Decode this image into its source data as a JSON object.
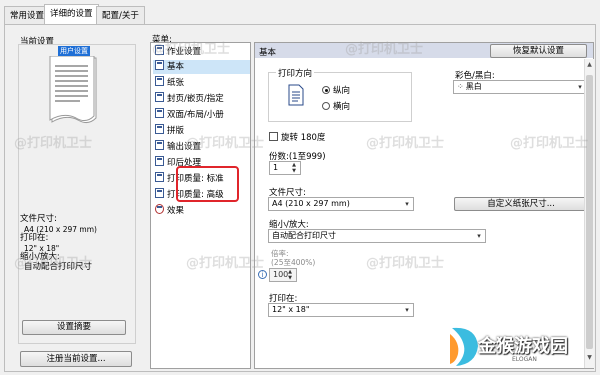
{
  "tabs": [
    {
      "label": "常用设置",
      "active": false
    },
    {
      "label": "详细的设置",
      "active": true
    },
    {
      "label": "配置/关于",
      "active": false
    }
  ],
  "left": {
    "current_settings_label": "当前设置",
    "preview_header": "用户设置",
    "info": {
      "paper_size_label": "文件尺寸:",
      "paper_size_value": "A4 (210 x 297 mm)",
      "print_on_label": "打印在:",
      "print_on_value": "12\" x 18\"",
      "zoom_label": "缩小/放大:",
      "zoom_value": "自动配合打印尺寸"
    },
    "summary_button": "设置摘要",
    "register_button": "注册当前设置..."
  },
  "menu": {
    "label": "菜单:",
    "items": [
      {
        "label": "作业设置",
        "selected": false
      },
      {
        "label": "基本",
        "selected": true
      },
      {
        "label": "纸张",
        "selected": false
      },
      {
        "label": "封页/嵌页/指定",
        "selected": false
      },
      {
        "label": "双面/布局/小册",
        "selected": false
      },
      {
        "label": "拼版",
        "selected": false
      },
      {
        "label": "输出设置",
        "selected": false
      },
      {
        "label": "印后处理",
        "selected": false
      },
      {
        "label": "打印质量: 标准",
        "selected": false
      },
      {
        "label": "打印质量: 高级",
        "selected": false
      },
      {
        "label": "效果",
        "selected": false
      }
    ]
  },
  "main": {
    "header": "基本",
    "restore_button": "恢复默认设置",
    "orientation": {
      "label": "打印方向",
      "options": [
        "纵向",
        "横向"
      ],
      "selected": "纵向"
    },
    "color": {
      "label": "彩色/黑白:",
      "value": "黑白"
    },
    "rotate": {
      "label": "旋转 180度",
      "checked": false
    },
    "copies": {
      "label": "份数:(1至999)",
      "value": "1"
    },
    "paper_size": {
      "label": "文件尺寸:",
      "value": "A4 (210 x 297 mm)"
    },
    "custom_size_button": "自定义纸张尺寸...",
    "zoom": {
      "label": "缩小/放大:",
      "value": "自动配合打印尺寸"
    },
    "ratio": {
      "label": "倍率:",
      "range": "(25至400%)",
      "value": "100"
    },
    "print_on": {
      "label": "打印在:",
      "value": "12\" x 18\""
    }
  },
  "watermarks": [
    "@打印机卫士",
    "@打印机卫士",
    "@打印机卫士",
    "@打印机卫士",
    "@打印机卫士",
    "@打印机卫士",
    "@打印机卫士",
    "@打印机卫士",
    "@打印机卫士"
  ],
  "logo": {
    "text": "金猴游戏园",
    "sub": "ELOGAN"
  },
  "colors": {
    "highlight_box": "#e0252b",
    "selection": "#cde5f8",
    "header_bg": "#d6dbe9"
  }
}
